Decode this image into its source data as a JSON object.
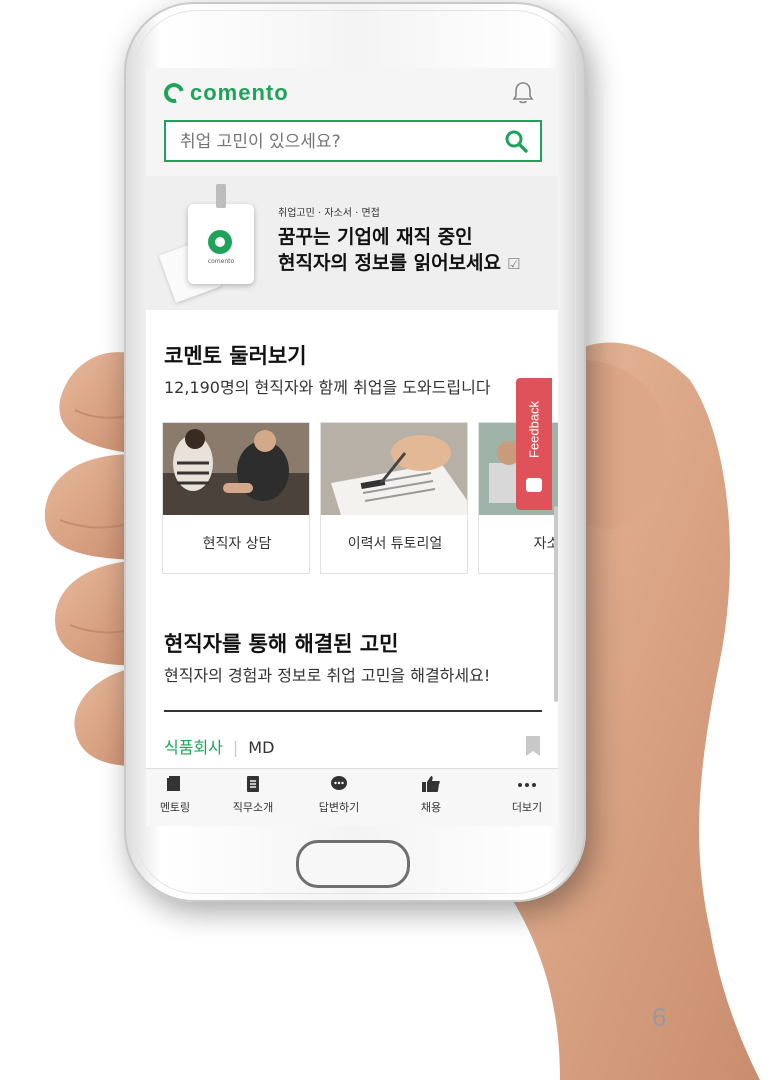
{
  "app": {
    "logo_text": "comento"
  },
  "search": {
    "placeholder": "취업 고민이 있으세요?"
  },
  "banner": {
    "small_text": "취업고민 · 자소서 · 면접",
    "line1": "꿈꾸는 기업에 재직 중인",
    "line2": "현직자의 정보를 읽어보세요",
    "badge_text": "comento"
  },
  "section_browse": {
    "title": "코멘토 둘러보기",
    "subtitle": "12,190명의 현직자와 함께 취업을 도와드립니다",
    "cards": [
      {
        "label": "현직자 상담",
        "icon": "people-photo"
      },
      {
        "label": "이력서 튜토리얼",
        "icon": "resume-photo"
      },
      {
        "label": "자소서",
        "icon": "laptop-photo"
      }
    ]
  },
  "section_solved": {
    "title": "현직자를 통해 해결된 고민",
    "subtitle": "현직자의 경험과 정보로 취업 고민을 해결하세요!",
    "tag_company": "식품회사",
    "tag_role": "MD"
  },
  "bottom_nav": {
    "items": [
      {
        "label": "멘토링",
        "icon": "mentoring-icon"
      },
      {
        "label": "직무소개",
        "icon": "job-intro-icon"
      },
      {
        "label": "답변하기",
        "icon": "answer-icon"
      },
      {
        "label": "채용",
        "icon": "thumbs-up-icon"
      },
      {
        "label": "더보기",
        "icon": "more-icon"
      }
    ]
  },
  "feedback": {
    "label": "Feedback"
  },
  "page": {
    "number": "6"
  },
  "colors": {
    "brand_green": "#1fa35a",
    "feedback_red": "#e0525a"
  }
}
